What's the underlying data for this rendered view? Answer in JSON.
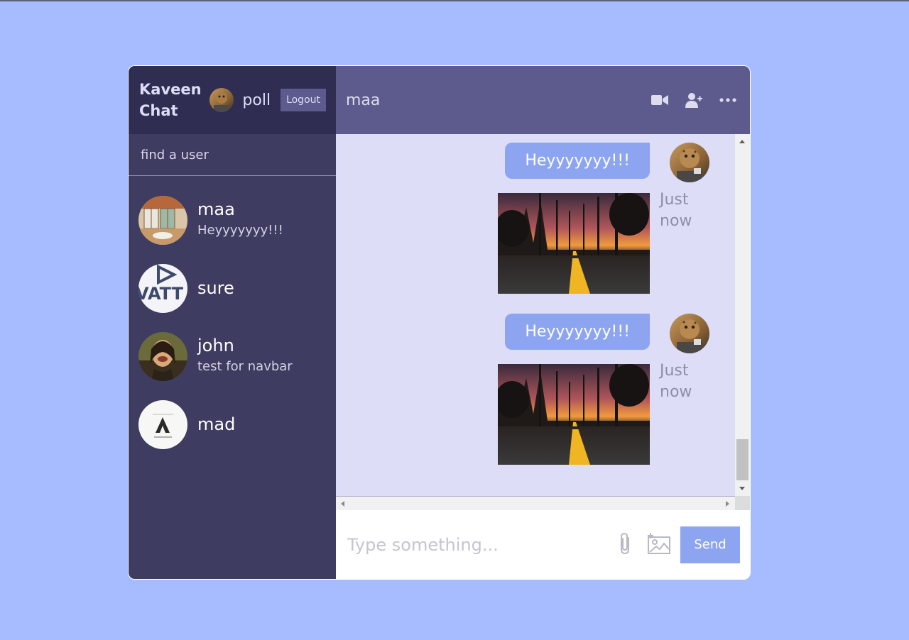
{
  "sidebar": {
    "logo": "Kaveen Chat",
    "current_user": {
      "name": "poll"
    },
    "logout_label": "Logout",
    "search_placeholder": "find a user",
    "chats": [
      {
        "name": "maa",
        "last_message": "Heyyyyyyy!!!"
      },
      {
        "name": "sure",
        "last_message": ""
      },
      {
        "name": "john",
        "last_message": "test for navbar"
      },
      {
        "name": "mad",
        "last_message": ""
      }
    ]
  },
  "chat": {
    "title": "maa",
    "icons": [
      "video-camera-icon",
      "add-user-icon",
      "more-icon"
    ],
    "messages": [
      {
        "text": "Heyyyyyyy!!!",
        "time": "Just now",
        "has_image": true
      },
      {
        "text": "Heyyyyyyy!!!",
        "time": "Just now",
        "has_image": true
      }
    ],
    "input_placeholder": "Type something...",
    "send_label": "Send"
  },
  "colors": {
    "background": "#a7bcff",
    "sidebar": "#3e3c61",
    "navbar": "#2f2d52",
    "chat_header": "#5d5b8d",
    "chat_bg": "#ddddf7",
    "bubble": "#8da4f1"
  }
}
